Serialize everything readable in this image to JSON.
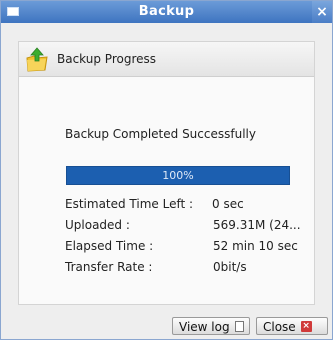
{
  "window": {
    "title": "Backup",
    "close_glyph": "×"
  },
  "panel": {
    "header_title": "Backup Progress",
    "icon": "backup-folder-icon"
  },
  "status": {
    "message": "Backup Completed Successfully"
  },
  "progress": {
    "percent": 100,
    "label": "100%"
  },
  "stats": [
    {
      "label": "Estimated Time Left :",
      "value": "0 sec"
    },
    {
      "label": "Uploaded :",
      "value": "569.31M (24..."
    },
    {
      "label": "Elapsed Time :",
      "value": "52 min 10 sec"
    },
    {
      "label": "Transfer Rate :",
      "value": "0bit/s"
    }
  ],
  "buttons": {
    "view_log": "View log",
    "close": "Close"
  },
  "colors": {
    "titlebar": "#4a7dc6",
    "progress": "#1c5fb0",
    "close_icon": "#d03a3a"
  }
}
